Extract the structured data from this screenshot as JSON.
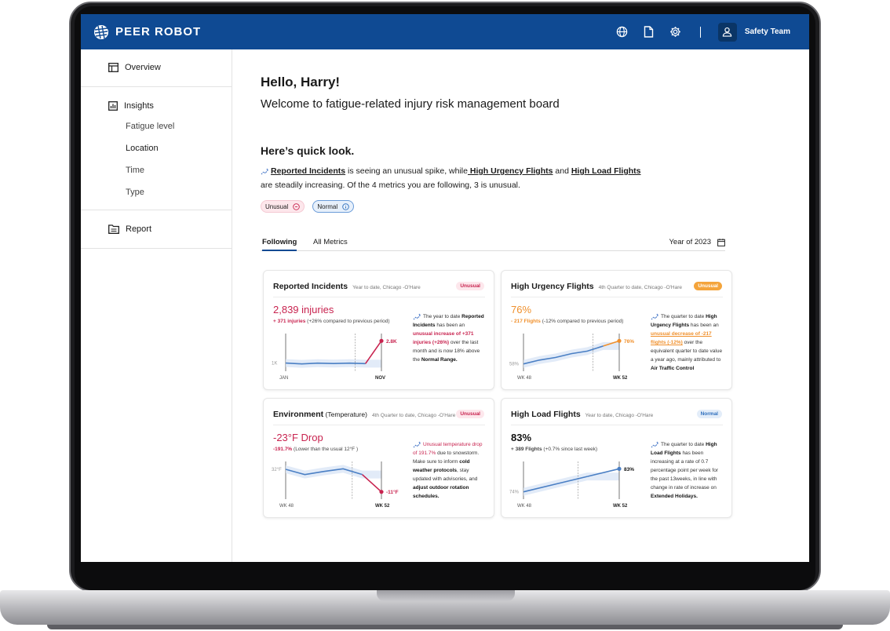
{
  "brand": {
    "name": "PEER ROBOT"
  },
  "header": {
    "team_label": "Safety Team"
  },
  "sidebar": {
    "overview": "Overview",
    "insights": "Insights",
    "insight_items": [
      "Fatigue level",
      "Location",
      "Time",
      "Type"
    ],
    "report": "Report"
  },
  "greeting": {
    "hello": "Hello, Harry!",
    "welcome": "Welcome to fatigue-related injury risk management board"
  },
  "quicklook": {
    "title": "Here’s quick look.",
    "link_reported": "Reported Incidents",
    "text_a": " is seeing an unusual spike, while",
    "link_urgency": " High Urgency Flights",
    "text_b": " and ",
    "link_load": "High Load Flights ",
    "text_c": "are steadily increasing. Of the 4 metrics you are following, 3 is unusual."
  },
  "legend": {
    "unusual": "Unusual",
    "normal": "Normal"
  },
  "tabs": {
    "following": "Following",
    "all": "All Metrics",
    "year": "Year of 2023"
  },
  "colors": {
    "brand": "#0f4a93",
    "unusual": "#c8234f",
    "warning": "#f0902c",
    "normal": "#2f6fbd",
    "line": "#4a7fc4",
    "band": "#dbe6f6"
  },
  "cards": [
    {
      "title": "Reported Incidents",
      "title_suffix": "",
      "meta": "Year to date, Chicago -O'Hare",
      "status": "Unusual",
      "big": "2,839 injuries",
      "delta_strong": "+ 371 injuries",
      "delta_rest": " (+26% compared to previous period)",
      "note": {
        "a": "The year to date ",
        "b": "Reported Incidents",
        "c": " has been an ",
        "d": "unusual increase of +371 injuries (+26%)",
        "e": " over the last month and is now 18% above the ",
        "f": "Normal Range."
      }
    },
    {
      "title": "High Urgency Flights",
      "title_suffix": "",
      "meta": "4th Quarter to date, Chicago -O'Hare",
      "status": "Unusual",
      "big": "76%",
      "delta_strong": "- 217 Flights",
      "delta_rest": " (-12% compared to previous period)",
      "note": {
        "a": "The quarter to date ",
        "b": "High Urgency Flights",
        "c": " has been an ",
        "d": "unusual decrease of -217 flights (-12%)",
        "e": " over the equivalent quarter to date value a year ago, mainly attributed to ",
        "f": "Air Traffic Control"
      }
    },
    {
      "title": "Environment",
      "title_suffix": " (Temperature)",
      "meta": "4th Quarter to date, Chicago -O'Hare",
      "status": "Unusual",
      "big": "-23°F Drop",
      "delta_strong": "-191.7%",
      "delta_rest": " (Lower than the usual 12°F )",
      "note": {
        "a": "",
        "b": "",
        "c": "",
        "d": "Unusual temperature drop of 191.7%",
        "e": " due to snowstorm. Make sure to inform ",
        "f": "cold weather protocols",
        "g": ", stay updated with advisories, and ",
        "h": "adjust outdoor rotation schedules."
      }
    },
    {
      "title": "High Load Flights",
      "title_suffix": "",
      "meta": "Year to date, Chicago -O'Hare",
      "status": "Normal",
      "big": "83%",
      "delta_strong": "+ 389 Flights",
      "delta_rest": " (+0.7% since last week)",
      "note": {
        "a": "The quarter to date ",
        "b": "High Load Flights",
        "c": " has been increasing at a rate of 0.7 percentage point per week for the past 13weeks, in line with change in rate of increase on ",
        "d": "Extended Holidays."
      }
    }
  ],
  "chart_data": [
    {
      "type": "line",
      "title": "Reported Incidents",
      "x_labels": [
        "JAN",
        "NOV"
      ],
      "y_tick": "1K",
      "end_label": "2.8K",
      "values": [
        1000,
        930,
        990,
        960,
        990,
        950,
        2800
      ],
      "normal_range": true
    },
    {
      "type": "line",
      "title": "High Urgency Flights",
      "x_labels": [
        "WK 48",
        "WK 52"
      ],
      "y_tick": "58%",
      "end_label": "76%",
      "values": [
        58,
        61,
        63,
        66,
        68,
        72,
        76
      ],
      "normal_range": true
    },
    {
      "type": "line",
      "title": "Environment (Temperature)",
      "x_labels": [
        "WK 48",
        "WK 52"
      ],
      "y_tick": "32°F",
      "end_label": "-11°F",
      "values": [
        32,
        22,
        28,
        33,
        22,
        -11
      ],
      "normal_range": true
    },
    {
      "type": "line",
      "title": "High Load Flights",
      "x_labels": [
        "WK 48",
        "WK 52"
      ],
      "y_tick": "74%",
      "end_label": "83%",
      "values": [
        74,
        77,
        80,
        83
      ],
      "normal_range": true
    }
  ]
}
